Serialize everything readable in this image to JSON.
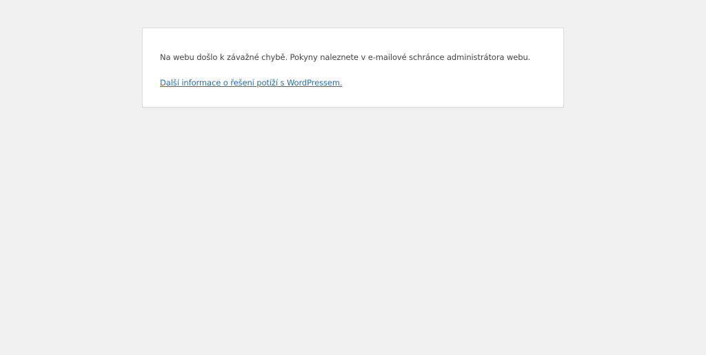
{
  "error": {
    "message": "Na webu došlo k závažné chybě. Pokyny naleznete v e-mailové schránce administrátora webu.",
    "help_link_text": "Další informace o řešení potíží s WordPressem."
  },
  "colors": {
    "background": "#f1f1f1",
    "panel": "#ffffff",
    "text": "#444444",
    "link": "#2271b1"
  }
}
